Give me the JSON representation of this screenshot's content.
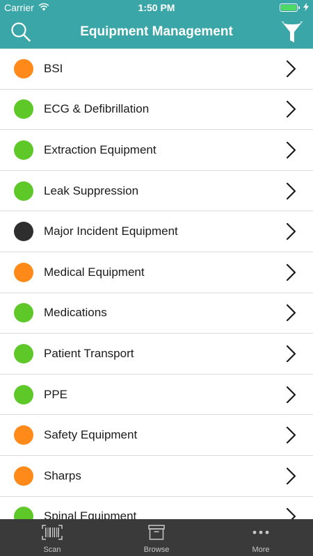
{
  "status_bar": {
    "carrier": "Carrier",
    "time": "1:50 PM",
    "battery_color": "#4cd964",
    "battery_level": 1.0
  },
  "nav": {
    "title": "Equipment Management",
    "left_icon": "search-icon",
    "right_icon": "filter-icon"
  },
  "colors": {
    "header_bg": "#3aa6a8",
    "status_orange": "#ff8a1a",
    "status_green": "#5ec829",
    "status_black": "#2e2e2e",
    "tab_bar_bg": "#3a3a3a"
  },
  "list": {
    "items": [
      {
        "label": "BSI",
        "status": "orange",
        "color": "#ff8a1a"
      },
      {
        "label": "ECG & Defibrillation",
        "status": "green",
        "color": "#5ec829"
      },
      {
        "label": "Extraction Equipment",
        "status": "green",
        "color": "#5ec829"
      },
      {
        "label": "Leak Suppression",
        "status": "green",
        "color": "#5ec829"
      },
      {
        "label": "Major Incident Equipment",
        "status": "black",
        "color": "#2e2e2e"
      },
      {
        "label": "Medical Equipment",
        "status": "orange",
        "color": "#ff8a1a"
      },
      {
        "label": "Medications",
        "status": "green",
        "color": "#5ec829"
      },
      {
        "label": "Patient Transport",
        "status": "green",
        "color": "#5ec829"
      },
      {
        "label": "PPE",
        "status": "green",
        "color": "#5ec829"
      },
      {
        "label": "Safety Equipment",
        "status": "orange",
        "color": "#ff8a1a"
      },
      {
        "label": "Sharps",
        "status": "orange",
        "color": "#ff8a1a"
      },
      {
        "label": "Spinal Equipment",
        "status": "green",
        "color": "#5ec829"
      }
    ]
  },
  "tab_bar": {
    "tabs": [
      {
        "label": "Scan",
        "icon": "barcode-icon"
      },
      {
        "label": "Browse",
        "icon": "archive-box-icon"
      },
      {
        "label": "More",
        "icon": "more-dots-icon"
      }
    ]
  }
}
